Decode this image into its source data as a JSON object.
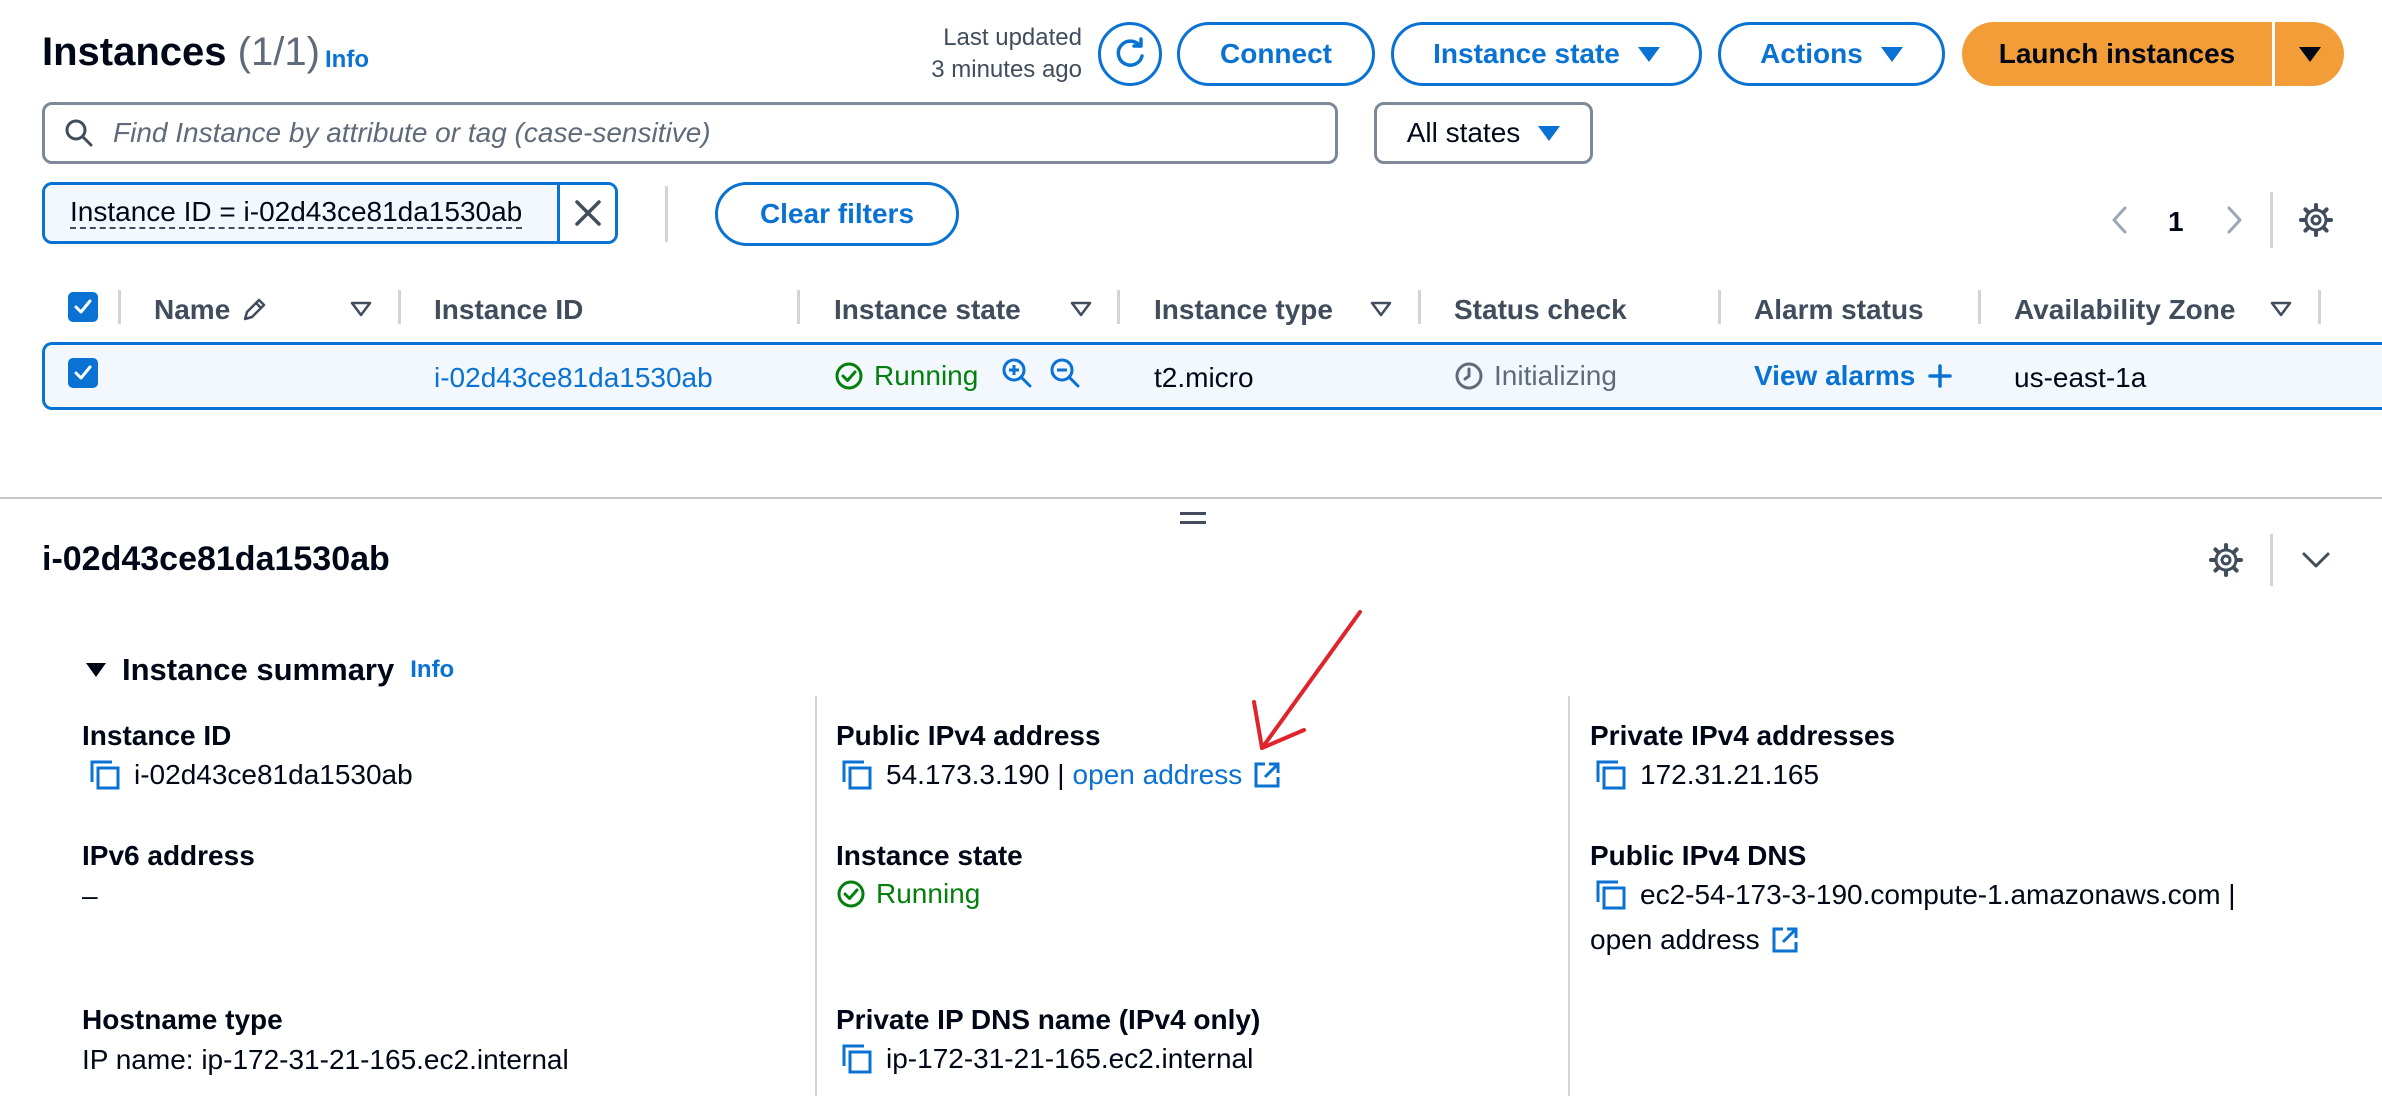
{
  "header": {
    "title": "Instances",
    "count": "(1/1)",
    "info": "Info",
    "last_updated_line1": "Last updated",
    "last_updated_line2": "3 minutes ago",
    "connect": "Connect",
    "instance_state": "Instance state",
    "actions": "Actions",
    "launch": "Launch instances"
  },
  "search": {
    "placeholder": "Find Instance by attribute or tag (case-sensitive)",
    "states_select": "All states"
  },
  "filter": {
    "token": "Instance ID = i-02d43ce81da1530ab",
    "clear": "Clear filters"
  },
  "pagination": {
    "page": "1"
  },
  "table": {
    "columns": [
      "Name",
      "Instance ID",
      "Instance state",
      "Instance type",
      "Status check",
      "Alarm status",
      "Availability Zone"
    ],
    "row": {
      "name": "",
      "instance_id": "i-02d43ce81da1530ab",
      "state": "Running",
      "type": "t2.micro",
      "status": "Initializing",
      "alarm": "View alarms",
      "az": "us-east-1a"
    }
  },
  "detail": {
    "title": "i-02d43ce81da1530ab",
    "summary_title": "Instance summary",
    "summary_info": "Info",
    "instance_id_label": "Instance ID",
    "instance_id_value": "i-02d43ce81da1530ab",
    "ipv6_label": "IPv6 address",
    "ipv6_value": "–",
    "hostname_label": "Hostname type",
    "hostname_value": "IP name: ip-172-31-21-165.ec2.internal",
    "public_ipv4_label": "Public IPv4 address",
    "public_ipv4_value": "54.173.3.190 |",
    "open_address": "open address",
    "state_label": "Instance state",
    "state_value": "Running",
    "private_dns_label": "Private IP DNS name (IPv4 only)",
    "private_dns_value": "ip-172-31-21-165.ec2.internal",
    "private_ipv4_label": "Private IPv4 addresses",
    "private_ipv4_value": "172.31.21.165",
    "public_dns_label": "Public IPv4 DNS",
    "public_dns_value": "ec2-54-173-3-190.compute-1.amazonaws.com |",
    "open_address_2": "open address"
  },
  "colors": {
    "accent": "#0972d3",
    "launch": "#f29d38",
    "running": "#037f0c",
    "annotation_arrow": "#e0242b"
  }
}
